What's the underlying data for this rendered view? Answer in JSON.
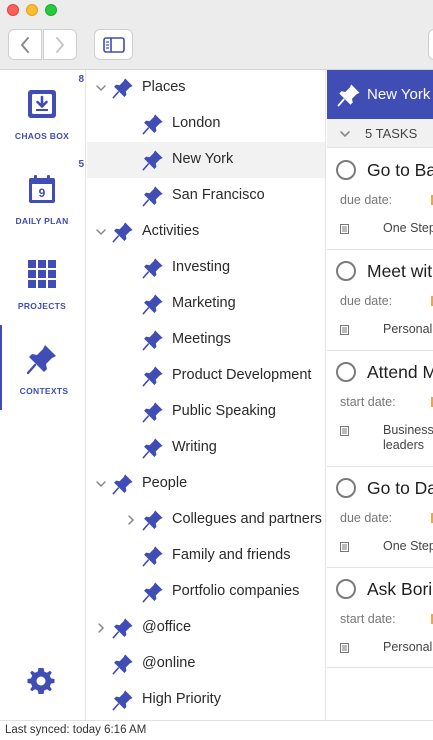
{
  "window": {
    "controls": [
      "close",
      "minimize",
      "zoom"
    ]
  },
  "toolbar": {
    "back_icon": "chevron-left-icon",
    "forward_icon": "chevron-right-icon",
    "sidebar_icon": "sidebar-toggle-icon"
  },
  "colors": {
    "accent": "#3f4db5",
    "selected_row": "#f2f2f2",
    "due_marker": "#f2a24a"
  },
  "rail": {
    "items": [
      {
        "label": "CHAOS BOX",
        "count": "8",
        "icon": "inbox-download-icon"
      },
      {
        "label": "DAILY PLAN",
        "count": "5",
        "icon": "calendar-icon",
        "calendar_day": "9"
      },
      {
        "label": "PROJECTS",
        "count": "",
        "icon": "grid-icon"
      },
      {
        "label": "CONTEXTS",
        "count": "",
        "icon": "pushpin-icon",
        "active": true
      }
    ],
    "settings_icon": "gear-icon"
  },
  "contexts": [
    {
      "label": "Places",
      "level": 0,
      "expanded": true
    },
    {
      "label": "London",
      "level": 1
    },
    {
      "label": "New York",
      "level": 1,
      "selected": true
    },
    {
      "label": "San Francisco",
      "level": 1
    },
    {
      "label": "Activities",
      "level": 0,
      "expanded": true
    },
    {
      "label": "Investing",
      "level": 1
    },
    {
      "label": "Marketing",
      "level": 1
    },
    {
      "label": "Meetings",
      "level": 1
    },
    {
      "label": "Product Development",
      "level": 1
    },
    {
      "label": "Public Speaking",
      "level": 1
    },
    {
      "label": "Writing",
      "level": 1
    },
    {
      "label": "People",
      "level": 0,
      "expanded": true
    },
    {
      "label": "Collegues and partners",
      "level": 1,
      "collapsed": true
    },
    {
      "label": "Family and friends",
      "level": 1
    },
    {
      "label": "Portfolio companies",
      "level": 1
    },
    {
      "label": "@office",
      "level": 0,
      "collapsed": true
    },
    {
      "label": "@online",
      "level": 0
    },
    {
      "label": "High Priority",
      "level": 0
    }
  ],
  "pane": {
    "title": "New York",
    "tasks_count": "5 TASKS"
  },
  "tasks": [
    {
      "title": "Go to Ba",
      "meta": "due date:",
      "project": "One Step"
    },
    {
      "title": "Meet wit",
      "meta": "due date:",
      "project": "Personal"
    },
    {
      "title": "Attend M",
      "meta": "start date:",
      "project": "Business",
      "project_line2": "leaders"
    },
    {
      "title": "Go to Da",
      "meta": "due date:",
      "project": "One Step"
    },
    {
      "title": "Ask Bori",
      "meta": "start date:",
      "project": "Personal"
    }
  ],
  "status": {
    "text": "Last synced: today 6:16 AM"
  }
}
